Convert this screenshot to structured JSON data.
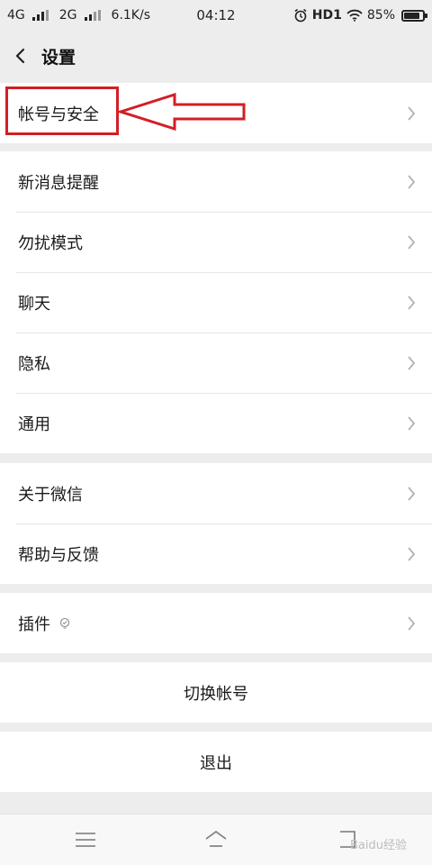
{
  "status_bar": {
    "network1": "4G",
    "network2": "2G",
    "speed": "6.1K/s",
    "time": "04:12",
    "hd": "HD1",
    "battery_text": "85%",
    "battery_level": 0.85
  },
  "header": {
    "title": "设置",
    "back_icon": "chevron-left-icon"
  },
  "groups": [
    {
      "items": [
        {
          "label": "帐号与安全"
        }
      ]
    },
    {
      "items": [
        {
          "label": "新消息提醒"
        },
        {
          "label": "勿扰模式"
        },
        {
          "label": "聊天"
        },
        {
          "label": "隐私"
        },
        {
          "label": "通用"
        }
      ]
    },
    {
      "items": [
        {
          "label": "关于微信"
        },
        {
          "label": "帮助与反馈"
        }
      ]
    },
    {
      "items": [
        {
          "label": "插件",
          "icon": "plugin-bulb-icon"
        }
      ]
    }
  ],
  "switch_account": "切换帐号",
  "logout": "退出",
  "colors": {
    "annotation": "#d31e25",
    "background": "#ededed",
    "card": "#ffffff"
  },
  "watermark": "Baidu经验"
}
